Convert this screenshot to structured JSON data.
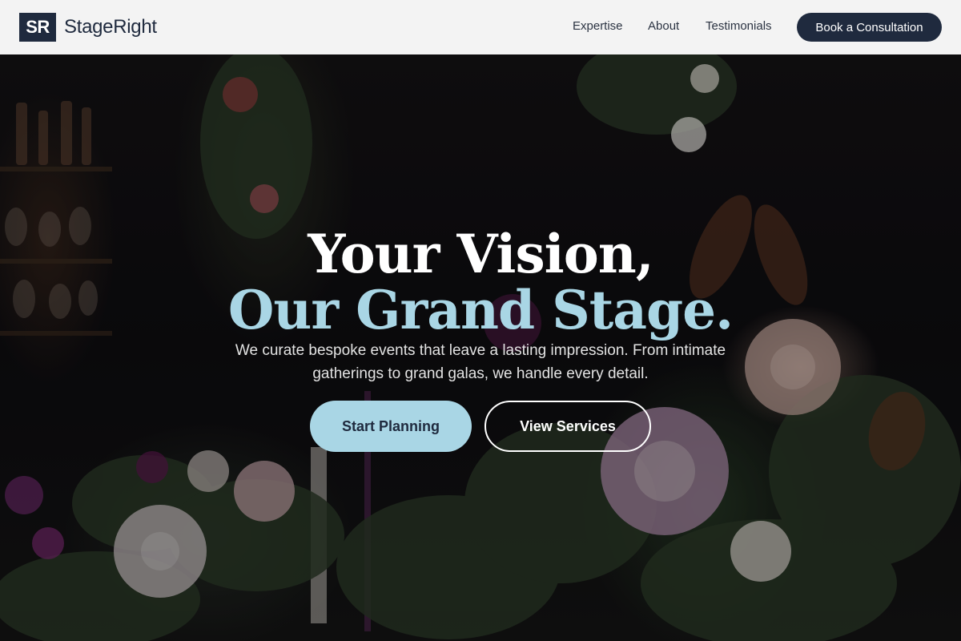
{
  "nav": {
    "logo_mark": "SR",
    "brand": "StageRight",
    "links": [
      "Expertise",
      "About",
      "Testimonials"
    ],
    "cta": "Book a Consultation"
  },
  "hero": {
    "headline_line1": "Your Vision,",
    "headline_line2": "Our Grand Stage.",
    "subtext": "We curate bespoke events that leave a lasting impression. From intimate gatherings to grand galas, we handle every detail.",
    "primary_button": "Start Planning",
    "secondary_button": "View Services",
    "background_image": "floral-arrangement-photo"
  },
  "colors": {
    "navy": "#1f2a3e",
    "accent_light_blue": "#a9d6e5",
    "nav_background": "#f3f3f3"
  }
}
